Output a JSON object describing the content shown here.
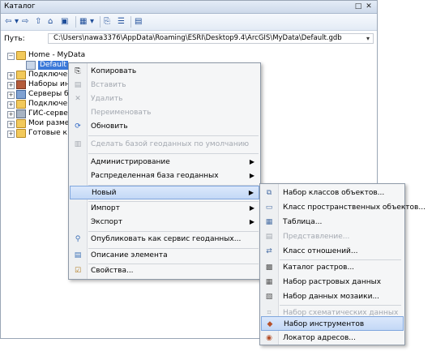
{
  "window": {
    "title": "Каталог",
    "float_btn": "□",
    "close_btn": "✕"
  },
  "toolbar": {
    "items": [
      {
        "name": "back-icon",
        "glyph": "⇦"
      },
      {
        "name": "back-dropdown-icon",
        "glyph": "▾"
      },
      {
        "name": "forward-icon",
        "glyph": "⇨"
      },
      {
        "name": "up-folder-icon",
        "glyph": "⇧"
      },
      {
        "name": "home-folder-icon",
        "glyph": "⌂"
      },
      {
        "name": "connect-folder-icon",
        "glyph": "▣"
      },
      {
        "name": "view-options-icon",
        "glyph": "▦"
      },
      {
        "name": "view-dropdown-icon",
        "glyph": "▾"
      },
      {
        "name": "toggle-tree-icon",
        "glyph": "⎘"
      },
      {
        "name": "options-icon",
        "glyph": "☰"
      },
      {
        "name": "details-icon",
        "glyph": "▤"
      }
    ]
  },
  "path": {
    "label": "Путь:",
    "value": "C:\\Users\\nawa3376\\AppData\\Roaming\\ESRI\\Desktop9.4\\ArcGIS\\MyData\\Default.gdb"
  },
  "tree": {
    "items": [
      {
        "label": "Home - MyData",
        "expander": "⊟"
      },
      {
        "label": "Default",
        "expander": ""
      },
      {
        "label": "Подключе",
        "expander": "⊞"
      },
      {
        "label": "Наборы ин",
        "expander": "⊞"
      },
      {
        "label": "Серверы б",
        "expander": "⊞"
      },
      {
        "label": "Подключе",
        "expander": "⊞"
      },
      {
        "label": "ГИС-серве",
        "expander": "⊞"
      },
      {
        "label": "Мои разме",
        "expander": "⊞"
      },
      {
        "label": "Готовые к",
        "expander": "⊞"
      }
    ]
  },
  "context_menu": {
    "items": [
      {
        "label": "Копировать",
        "icon": "⎘",
        "disabled": false,
        "arrow": ""
      },
      {
        "label": "Вставить",
        "icon": "▤",
        "disabled": true,
        "arrow": ""
      },
      {
        "label": "Удалить",
        "icon": "✕",
        "disabled": true,
        "arrow": ""
      },
      {
        "label": "Переименовать",
        "icon": "",
        "disabled": true,
        "arrow": ""
      },
      {
        "label": "Обновить",
        "icon": "⟳",
        "disabled": false,
        "arrow": ""
      },
      {
        "label": "Сделать базой геоданных по умолчанию",
        "icon": "▥",
        "disabled": true,
        "arrow": ""
      },
      {
        "label": "Администрирование",
        "icon": "",
        "disabled": false,
        "arrow": "▶"
      },
      {
        "label": "Распределенная база геоданных",
        "icon": "",
        "disabled": false,
        "arrow": "▶"
      },
      {
        "label": "Новый",
        "icon": "",
        "disabled": false,
        "arrow": "▶"
      },
      {
        "label": "Импорт",
        "icon": "",
        "disabled": false,
        "arrow": "▶"
      },
      {
        "label": "Экспорт",
        "icon": "",
        "disabled": false,
        "arrow": "▶"
      },
      {
        "label": "Опубликовать как сервис геоданных...",
        "icon": "⚲",
        "disabled": false,
        "arrow": ""
      },
      {
        "label": "Описание элемента",
        "icon": "▤",
        "disabled": false,
        "arrow": ""
      },
      {
        "label": "Свойства...",
        "icon": "☑",
        "disabled": false,
        "arrow": ""
      }
    ]
  },
  "submenu": {
    "items": [
      {
        "label": "Набор классов объектов...",
        "icon": "⧉",
        "disabled": false
      },
      {
        "label": "Класс пространственных объектов...",
        "icon": "▭",
        "disabled": false
      },
      {
        "label": "Таблица...",
        "icon": "▦",
        "disabled": false
      },
      {
        "label": "Представление...",
        "icon": "▤",
        "disabled": true
      },
      {
        "label": "Класс отношений...",
        "icon": "⇄",
        "disabled": false
      },
      {
        "label": "Каталог растров...",
        "icon": "▩",
        "disabled": false
      },
      {
        "label": "Набор растровых данных",
        "icon": "▦",
        "disabled": false
      },
      {
        "label": "Набор данных мозаики...",
        "icon": "▧",
        "disabled": false
      },
      {
        "label": "Набор схематических данных",
        "icon": "⌗",
        "disabled": true
      },
      {
        "label": "Набор инструментов",
        "icon": "◆",
        "disabled": false
      },
      {
        "label": "Локатор адресов...",
        "icon": "◉",
        "disabled": false
      }
    ]
  },
  "colors": {
    "selection": "#3a78d8",
    "menu_highlight": "#c3d8f6",
    "folder": "#f2c95a"
  }
}
